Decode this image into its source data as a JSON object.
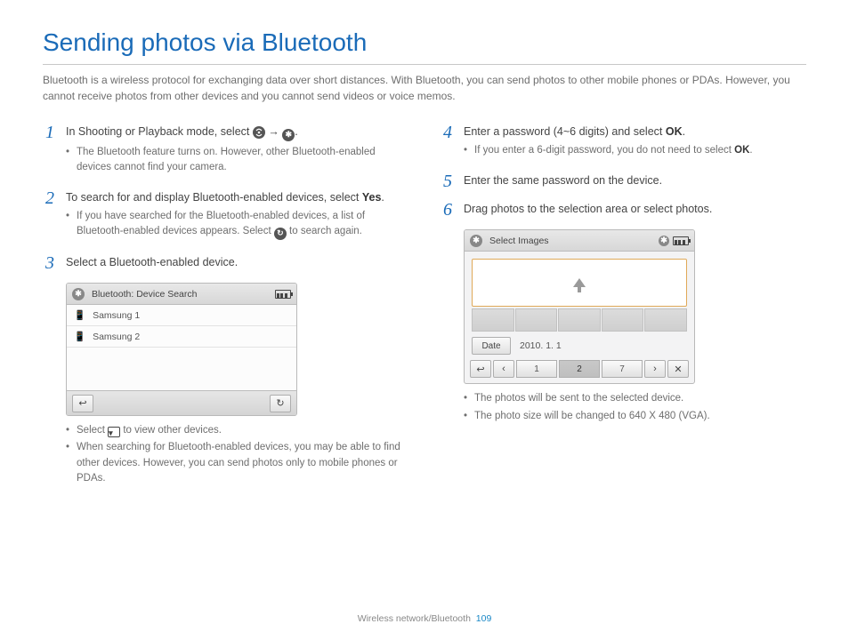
{
  "page": {
    "title": "Sending photos via Bluetooth",
    "intro": "Bluetooth is a wireless protocol for exchanging data over short distances. With Bluetooth, you can send photos to other mobile phones or PDAs. However, you cannot receive photos from other devices and you cannot send videos or voice memos.",
    "footer_section": "Wireless network/Bluetooth",
    "page_number": "109"
  },
  "left": {
    "step1": {
      "num": "1",
      "text_a": "In Shooting or Playback mode, select ",
      "text_b": " → ",
      "text_c": ".",
      "bullets": [
        "The Bluetooth feature turns on. However, other Bluetooth-enabled devices cannot find your camera."
      ]
    },
    "step2": {
      "num": "2",
      "text_a": "To search for and display Bluetooth-enabled devices, select ",
      "yes": "Yes",
      "text_b": ".",
      "bullets_a": "If you have searched for the Bluetooth-enabled devices, a list of Bluetooth-enabled devices appears. Select ",
      "bullets_b": " to search again."
    },
    "step3": {
      "num": "3",
      "text": "Select a Bluetooth-enabled device.",
      "screen": {
        "header": "Bluetooth: Device Search",
        "devices": [
          "Samsung 1",
          "Samsung 2"
        ]
      },
      "bullets_a": "Select ",
      "bullets_b": " to view other devices.",
      "bullets_c": "When searching for Bluetooth-enabled devices, you may be able to find other devices. However, you can send photos only to mobile phones or PDAs."
    }
  },
  "right": {
    "step4": {
      "num": "4",
      "text_a": "Enter a password (4~6 digits) and select ",
      "ok1": "OK",
      "text_b": ".",
      "bullets_a": "If you enter a 6-digit password, you do not need to select ",
      "ok2": "OK",
      "bullets_b": "."
    },
    "step5": {
      "num": "5",
      "text": "Enter the same password on the device."
    },
    "step6": {
      "num": "6",
      "text": "Drag photos to the selection area or select photos.",
      "screen": {
        "header": "Select Images",
        "date_label": "Date",
        "date_value": "2010. 1. 1",
        "pages": [
          "1",
          "2",
          "7"
        ]
      },
      "bullets": [
        "The photos will be sent to the selected device.",
        "The photo size will be changed to 640 X 480 (VGA)."
      ]
    }
  }
}
